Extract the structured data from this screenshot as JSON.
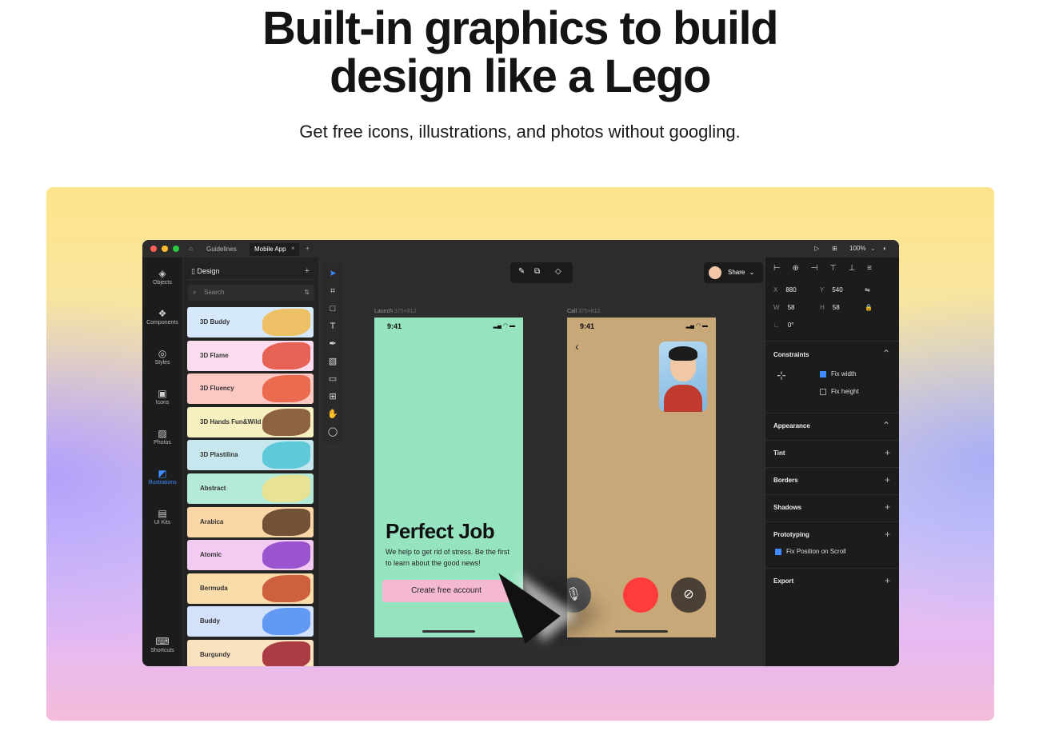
{
  "hero": {
    "title_line1": "Built-in graphics to build",
    "title_line2": "design like a Lego",
    "subtitle": "Get free icons, illustrations, and photos without googling."
  },
  "app": {
    "tabs": [
      {
        "label": "Guidelines",
        "active": false
      },
      {
        "label": "Mobile App",
        "active": true
      }
    ],
    "tab_close": "×",
    "new_tab": "+",
    "zoom": "100%",
    "rail": [
      {
        "label": "Objects",
        "icon": "layers-icon",
        "active": false
      },
      {
        "label": "Components",
        "icon": "components-icon",
        "active": false
      },
      {
        "label": "Styles",
        "icon": "styles-icon",
        "active": false
      },
      {
        "label": "Icons",
        "icon": "icons-icon",
        "active": false
      },
      {
        "label": "Photos",
        "icon": "photos-icon",
        "active": false
      },
      {
        "label": "Illustrations",
        "icon": "illustrations-icon",
        "active": true
      },
      {
        "label": "UI Kits",
        "icon": "ui-kits-icon",
        "active": false
      },
      {
        "label": "Shortcuts",
        "icon": "keyboard-icon",
        "active": false
      }
    ],
    "panel": {
      "header": "Design",
      "header_add": "+",
      "search_placeholder": "Search",
      "cards": [
        {
          "label": "3D Buddy",
          "bg": "#d6e9fb",
          "art": "#f2b84b"
        },
        {
          "label": "3D Flame",
          "bg": "#fbdcef",
          "art": "#e24c3a"
        },
        {
          "label": "3D Fluency",
          "bg": "#fbc9c3",
          "art": "#e85a3c"
        },
        {
          "label": "3D Hands Fun&Wild",
          "bg": "#f6f0c0",
          "art": "#7a4a2e"
        },
        {
          "label": "3D Plastilina",
          "bg": "#c7e7ef",
          "art": "#4cc3d6"
        },
        {
          "label": "Abstract",
          "bg": "#b6ead8",
          "art": "#f1e08a"
        },
        {
          "label": "Arabica",
          "bg": "#fbd7a7",
          "art": "#5a3a22"
        },
        {
          "label": "Atomic",
          "bg": "#f3cbf2",
          "art": "#8a3fc7"
        },
        {
          "label": "Bermuda",
          "bg": "#f8dcaa",
          "art": "#c74a2e"
        },
        {
          "label": "Buddy",
          "bg": "#d4e1fb",
          "art": "#4d8cf0"
        },
        {
          "label": "Burgundy",
          "bg": "#fbe2bf",
          "art": "#9b1e2e"
        }
      ]
    },
    "canvas": {
      "share_label": "Share",
      "frames": [
        {
          "name": "Launch",
          "size": "375×812"
        },
        {
          "name": "Call",
          "size": "375×812"
        }
      ],
      "status_time": "9:41",
      "launch": {
        "headline": "Perfect Job",
        "body": "We help to get rid of stress. Be the first to learn about the good news!",
        "button": "Create free account"
      }
    },
    "props": {
      "x": "880",
      "y": "540",
      "w": "58",
      "h": "58",
      "rotation": "0°",
      "constraints_title": "Constraints",
      "fix_width": {
        "label": "Fix width",
        "checked": true
      },
      "fix_height": {
        "label": "Fix height",
        "checked": false
      },
      "sections": [
        "Appearance",
        "Tint",
        "Borders",
        "Shadows",
        "Prototyping",
        "Export"
      ],
      "fix_position": {
        "label": "Fix Position on Scroll",
        "checked": true
      }
    }
  }
}
